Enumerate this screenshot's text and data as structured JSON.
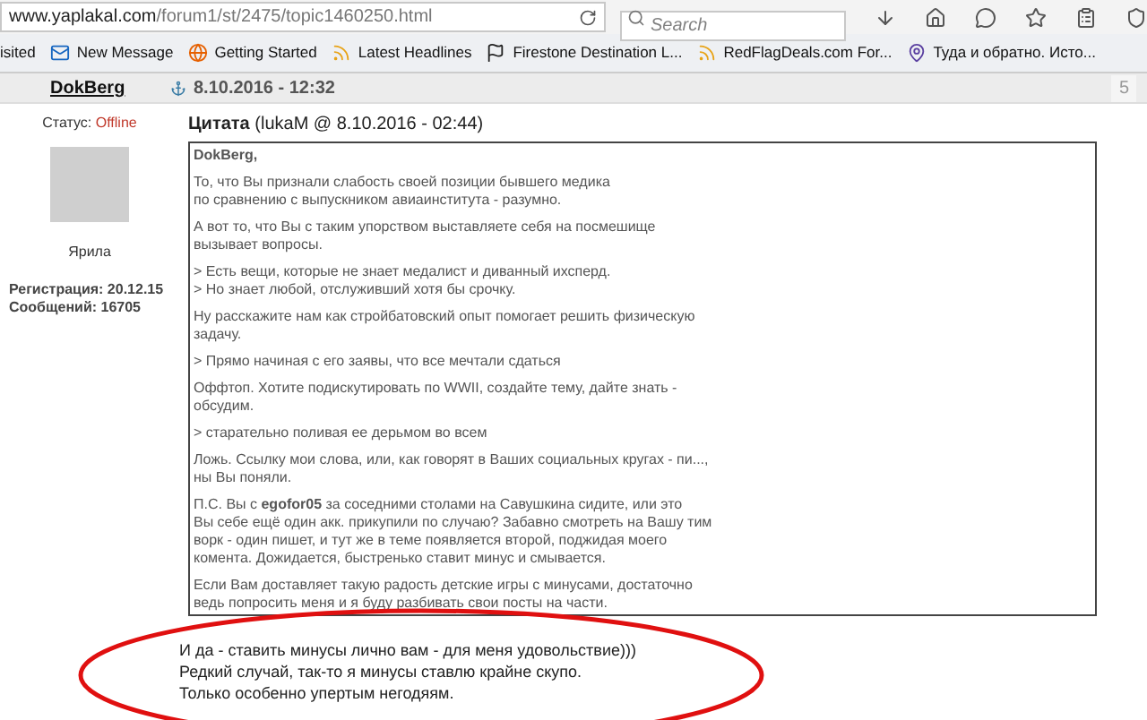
{
  "browser": {
    "url_domain": "www.yaplakal.com",
    "url_path": "/forum1/st/2475/topic1460250.html",
    "search": {
      "placeholder": "Search"
    },
    "bookmarks": [
      {
        "label": "isited",
        "kind": "plain"
      },
      {
        "label": "New Message",
        "kind": "mail"
      },
      {
        "label": "Getting Started",
        "kind": "firefox"
      },
      {
        "label": "Latest Headlines",
        "kind": "rss"
      },
      {
        "label": "Firestone Destination L...",
        "kind": "flag"
      },
      {
        "label": "RedFlagDeals.com For...",
        "kind": "rss"
      },
      {
        "label": "Туда и обратно. Исто...",
        "kind": "pin"
      }
    ]
  },
  "post": {
    "author": "DokBerg",
    "date": "8.10.2016 - 12:32",
    "number": "5",
    "user": {
      "status_label": "Статус:",
      "status": "Offline",
      "name": "Ярила",
      "registration": "Регистрация: 20.12.15",
      "messages": "Сообщений: 16705"
    },
    "quote": {
      "title": "**Цитата** (lukaM @ 8.10.2016 - 02:44)",
      "greeting": "DokBerg,",
      "paragraphs": [
        [
          "То, что Вы признали слабость своей позиции бывшего медика",
          "по сравнению с выпускником авиаинститута - разумно."
        ],
        [
          "А вот то, что Вы с таким упорством выставляете себя на посмешище",
          "вызывает вопросы."
        ],
        [
          "> Есть вещи, которые не знает медалист и диванный ихсперд.",
          "> Но знает любой, отслуживший хотя бы срочку."
        ],
        [
          "Ну расскажите нам как стройбатовский опыт помогает решить физическую",
          "задачу."
        ],
        [
          "> Прямо начиная с его заявы, что все мечтали сдаться"
        ],
        [
          "Оффтоп. Хотите подискутировать по WWII, создайте тему, дайте знать -",
          "обсудим."
        ],
        [
          "> старательно поливая ее дерьмом во всем"
        ],
        [
          "Ложь. Ссылку мои слова, или, как говорят в Ваших социальных кругах - пи...,",
          "ны Вы поняли."
        ],
        [
          "П.С. Вы с **egofor05** за соседними столами на Савушкина сидите, или это",
          "Вы себе ещё один акк. прикупили по случаю? Забавно смотреть на Вашу тим",
          "ворк - один пишет, и тут же в теме появляется второй, поджидая моего",
          "комента. Дожидается, быстренько ставит минус и смывается."
        ],
        [
          "Если Вам доставляет такую радость детские игры с минусами, достаточно",
          "ведь попросить меня и я буду разбивать свои посты на части."
        ]
      ]
    },
    "reply": [
      "И да - ставить минусы лично вам - для меня удовольствие)))",
      "Редкий случай, так-то я минусы ставлю крайне скупо.",
      "Только особенно упертым негодяям."
    ]
  }
}
